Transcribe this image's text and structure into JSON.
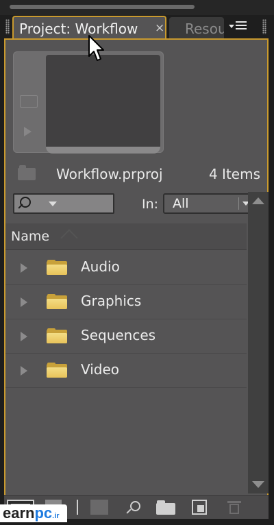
{
  "tabs": {
    "active_label": "Project: Workflow",
    "close_symbol": "×",
    "inactive_label": "Resources"
  },
  "project": {
    "file_name": "Workflow.prproj",
    "item_count": "4 Items"
  },
  "filter": {
    "in_label": "In:",
    "in_value": "All"
  },
  "list": {
    "column_name": "Name",
    "items": [
      {
        "label": "Audio"
      },
      {
        "label": "Graphics"
      },
      {
        "label": "Sequences"
      },
      {
        "label": "Video"
      }
    ]
  },
  "watermark": {
    "part1": "earn",
    "part2": "pc",
    "part3": ".ir"
  },
  "colors": {
    "panel_bg": "#555455",
    "active_border": "#c99a2e",
    "folder": "#e8c35a"
  },
  "icons": [
    "menu-icon",
    "search-icon",
    "dropdown-icon",
    "folder-icon",
    "expand-triangle-icon",
    "list-view-icon",
    "icon-view-icon",
    "automate-icon",
    "find-icon",
    "new-bin-icon",
    "new-item-icon",
    "clear-icon",
    "mouse-cursor-icon"
  ]
}
